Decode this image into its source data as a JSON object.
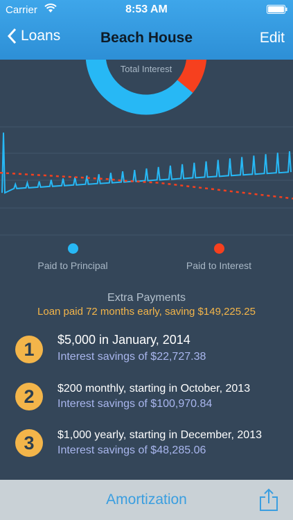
{
  "status_bar": {
    "carrier": "Carrier",
    "time": "8:53 AM"
  },
  "nav": {
    "back_label": "Loans",
    "title": "Beach House",
    "edit_label": "Edit"
  },
  "donut": {
    "label": "Total Interest",
    "principal_fraction": 0.64,
    "interest_fraction": 0.36,
    "principal_color": "#27b8f5",
    "interest_color": "#f6401e"
  },
  "chart_data": {
    "type": "line",
    "series": [
      {
        "name": "Paid to Principal",
        "color": "#27b8f5",
        "values": [
          56,
          62,
          63,
          64,
          65,
          66,
          67,
          68,
          69,
          70,
          71,
          72,
          73,
          74,
          75,
          76,
          77,
          78,
          79,
          80,
          81,
          82,
          83,
          84,
          85
        ]
      },
      {
        "name": "Paid to Interest",
        "color": "#f6401e",
        "values": [
          84,
          83,
          82,
          81,
          80,
          79,
          78,
          77,
          76,
          75,
          73,
          72,
          71,
          70,
          68,
          66,
          64,
          62,
          60,
          58,
          56,
          54,
          52,
          50,
          48
        ]
      }
    ],
    "spike_values": [
      140,
      68,
      70,
      72,
      74,
      76,
      78,
      80,
      82,
      84,
      86,
      88,
      90,
      92,
      94,
      96,
      98,
      100,
      102,
      104,
      106,
      108,
      110,
      112,
      114
    ],
    "grid": true
  },
  "legend": {
    "principal_label": "Paid to Principal",
    "interest_label": "Paid to Interest"
  },
  "extra_payments": {
    "title": "Extra Payments",
    "summary": "Loan paid 72 months early, saving $149,225.25",
    "items": [
      {
        "number": "1",
        "description": "$5,000 in January, 2014",
        "savings": "Interest savings of $22,727.38"
      },
      {
        "number": "2",
        "description": "$200 monthly, starting in October, 2013",
        "savings": "Interest savings of $100,970.84"
      },
      {
        "number": "3",
        "description": "$1,000 yearly, starting in December, 2013",
        "savings": "Interest savings of $48,285.06"
      }
    ]
  },
  "tabbar": {
    "amortization_label": "Amortization"
  }
}
